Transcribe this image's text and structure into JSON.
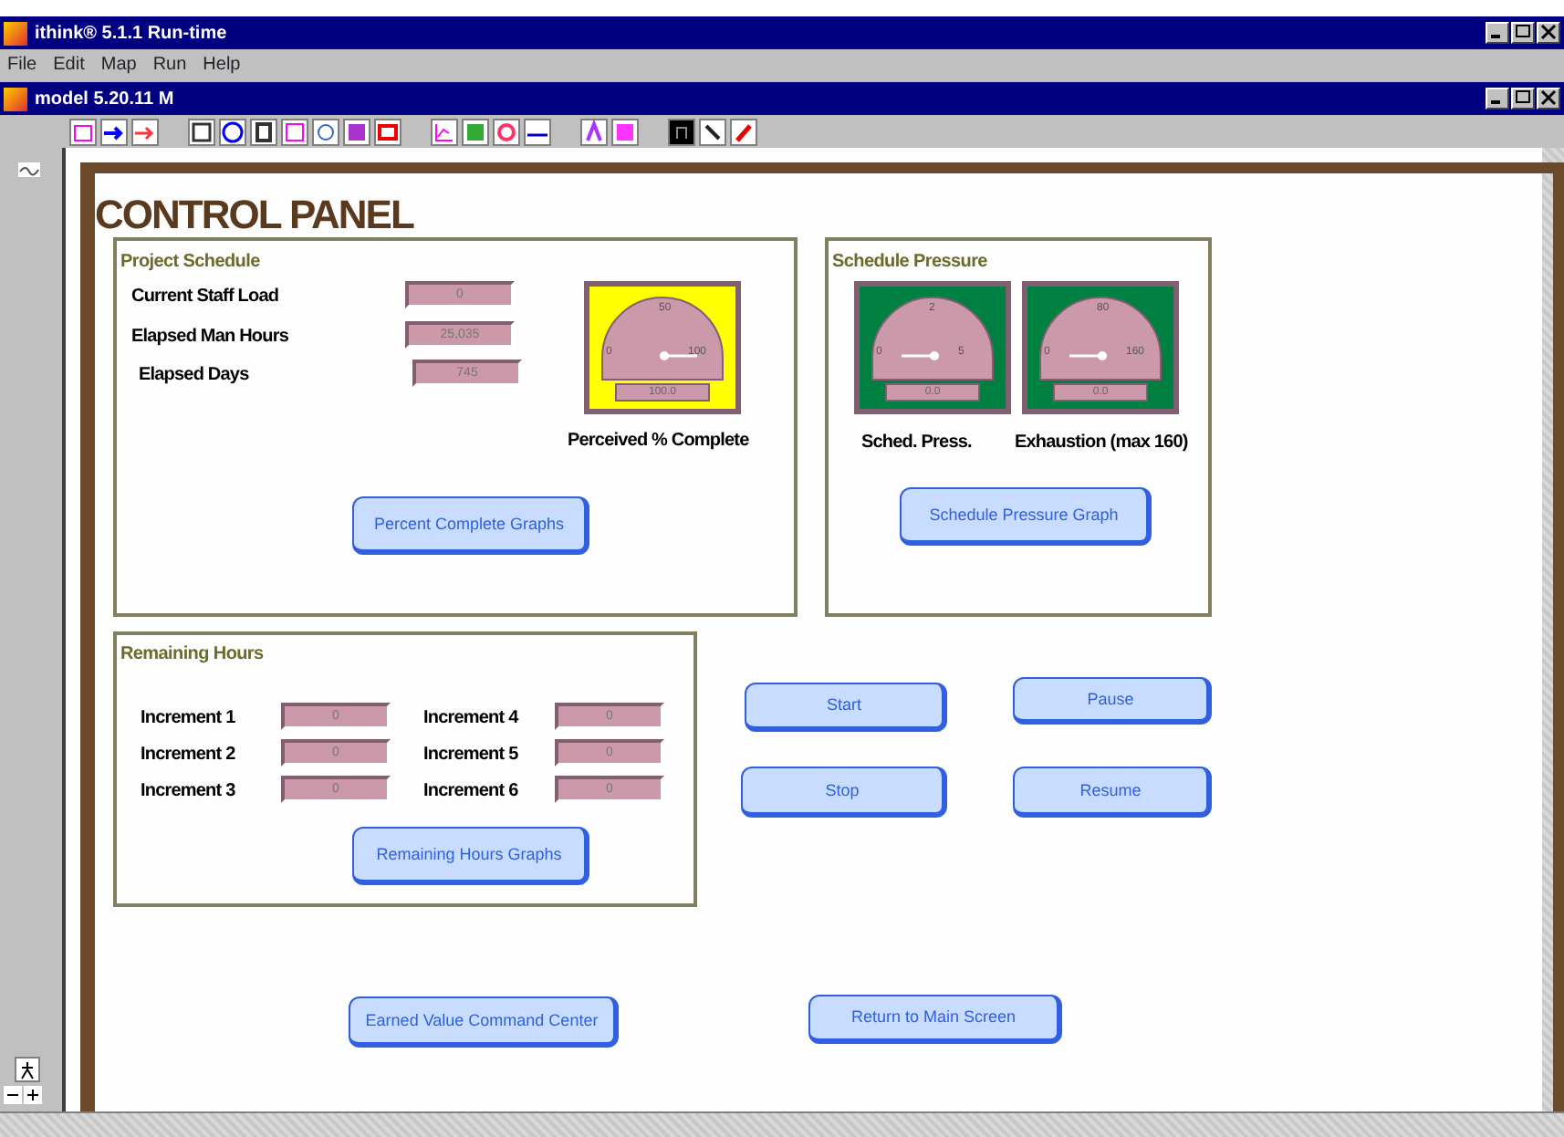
{
  "app_window": {
    "title": "ithink® 5.1.1 Run-time"
  },
  "menu": [
    "File",
    "Edit",
    "Map",
    "Run",
    "Help"
  ],
  "model_window": {
    "title": "model 5.20.11 M"
  },
  "heading": "CONTROL PANEL",
  "project_schedule": {
    "title": "Project Schedule",
    "fields": [
      {
        "label": "Current Staff Load",
        "value": "0"
      },
      {
        "label": "Elapsed Man Hours",
        "value": "25,035"
      },
      {
        "label": "Elapsed Days",
        "value": "745"
      }
    ],
    "gauges": [
      {
        "color": "#ffff00",
        "ticks": [
          "0",
          "50",
          "100"
        ],
        "reading": "100.0",
        "label": "Perceived % Complete"
      }
    ],
    "button": "Percent Complete Graphs"
  },
  "schedule_pressure": {
    "title": "Schedule Pressure",
    "gauges": [
      {
        "color": "#008040",
        "ticks": [
          "0",
          "2",
          "5"
        ],
        "reading": "0.0",
        "label": "Sched. Press."
      },
      {
        "color": "#008040",
        "ticks": [
          "0",
          "80",
          "160"
        ],
        "reading": "0.0",
        "label": "Exhaustion (max 160)"
      }
    ],
    "button": "Schedule Pressure Graph"
  },
  "remaining_hours": {
    "title": "Remaining Hours",
    "fields": [
      {
        "label": "Increment 1",
        "value": "0"
      },
      {
        "label": "Increment 2",
        "value": "0"
      },
      {
        "label": "Increment 3",
        "value": "0"
      },
      {
        "label": "Increment 4",
        "value": "0"
      },
      {
        "label": "Increment 5",
        "value": "0"
      },
      {
        "label": "Increment 6",
        "value": "0"
      }
    ],
    "button": "Remaining Hours Graphs"
  },
  "run_buttons": [
    "Start",
    "Pause",
    "Stop",
    "Resume"
  ],
  "bottom_buttons": [
    "Earned Value Command Center",
    "Return to Main Screen"
  ]
}
